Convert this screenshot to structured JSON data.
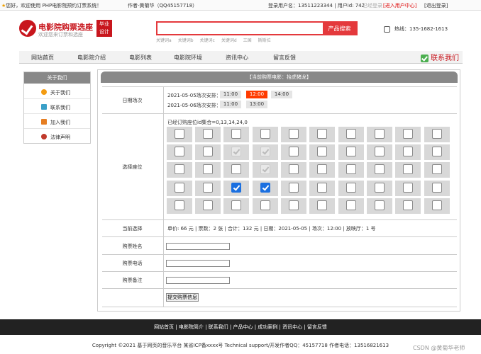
{
  "topbar": {
    "welcome": "您好，欢迎使用 PHP电影院预约订票系统！",
    "author": "作者-黄菊华（QQ45157718）",
    "login_user": "登录用户名：13511223344 | 用户id: 742",
    "logged_in": "已经登录",
    "user_center": "[进入用户中心]",
    "logout": "[退出登录]"
  },
  "logo": {
    "title": "电影院购票选座",
    "subtitle": "欢迎您来订票和选座",
    "badge_line1": "毕业",
    "badge_line2": "设计"
  },
  "search": {
    "placeholder": "",
    "button": "产品搜索",
    "keywords": [
      "关键词a",
      "关键词b",
      "关键词c",
      "关键词d",
      "三国",
      "斯斯拉"
    ]
  },
  "hotline": "热线：135-1682-1613",
  "nav": {
    "items": [
      "网站首页",
      "电影院介绍",
      "电影列表",
      "电影院环境",
      "资讯中心",
      "留言反馈"
    ],
    "contact": "联系我们"
  },
  "sidebar": {
    "title": "关于我们",
    "items": [
      "关于我们",
      "联系我们",
      "加入我们",
      "法律声明"
    ]
  },
  "booking": {
    "header": "【当前购票电影：抬虎猪龙】",
    "date_label": "日期场次",
    "schedules": [
      {
        "label": "2021-05-05场次安排：",
        "times": [
          "11:00",
          "12:00",
          "14:00"
        ],
        "selected": 1
      },
      {
        "label": "2021-05-06场次安排：",
        "times": [
          "11:00",
          "13:00"
        ],
        "selected": -1
      }
    ],
    "seat_label": "选择座位",
    "booked_info": "已经订购座位id集合=0,13,14,24,0",
    "seat_rows": [
      [
        "e",
        "e",
        "e",
        "e",
        "e",
        "e",
        "e",
        "e",
        "e",
        "e"
      ],
      [
        "e",
        "e",
        "s",
        "s",
        "e",
        "e",
        "e",
        "e",
        "e",
        "e"
      ],
      [
        "e",
        "e",
        "e",
        "s",
        "e",
        "e",
        "e",
        "e",
        "e",
        "e"
      ],
      [
        "e",
        "e",
        "c",
        "c",
        "e",
        "e",
        "e",
        "e",
        "e",
        "e"
      ],
      [
        "e",
        "e",
        "e",
        "e",
        "e",
        "e",
        "e",
        "e",
        "e",
        "e"
      ]
    ],
    "current_label": "当前选择",
    "summary": "单价: 66 元 | 票数：2 张 | 合计：132 元 | 日期：2021-05-05 | 场次：12:00 | 放映厅：1 号",
    "name_label": "购票姓名",
    "phone_label": "购票电话",
    "note_label": "购票备注",
    "submit": "提交购票信息"
  },
  "footer": {
    "nav": "网站首页 | 电影院简介 | 联系我们 | 产品中心 | 成功案例 | 资讯中心 | 留言反馈",
    "copyright": "Copyright ©2021 基于网页的音乐平台    某省ICP备xxxx号    Technical support/开发作者QQ：45157718    作者电话：13516821613",
    "watermark": "CSDN @黄菊华老师"
  },
  "colors": {
    "accent": "#c8161d",
    "search": "#e4393c",
    "selected_time": "#ff3b00",
    "selected_seat": "#1a6fe0"
  }
}
